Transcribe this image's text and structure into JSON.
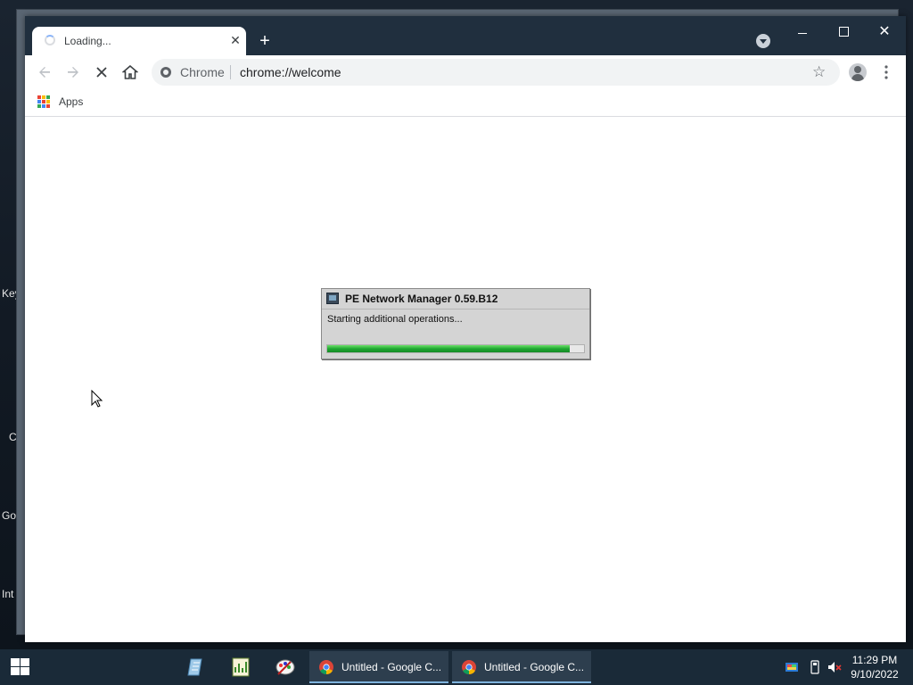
{
  "desktop": {
    "labels": [
      "Key",
      "C",
      "Go",
      "Int"
    ]
  },
  "browser": {
    "tab": {
      "title": "Loading..."
    },
    "omnibox": {
      "scheme_label": "Chrome",
      "url": "chrome://welcome"
    },
    "bookmarks": {
      "apps_label": "Apps"
    },
    "icons": {
      "back": "back-arrow-icon",
      "forward": "forward-arrow-icon",
      "stop": "stop-x-icon",
      "home": "home-icon",
      "star": "star-icon",
      "menu": "three-dot-menu-icon"
    }
  },
  "dialog": {
    "title": "PE Network Manager 0.59.B12",
    "status": "Starting additional operations...",
    "progress": 0.945
  },
  "taskbar": {
    "items": [
      {
        "label": "Untitled - Google C..."
      },
      {
        "label": "Untitled - Google C..."
      }
    ],
    "clock": {
      "time": "11:29 PM",
      "date": "9/10/2022"
    }
  },
  "colors": {
    "titlebar": "#202f3e",
    "taskbar": "#1a2a38",
    "progress_green": "#1fa832"
  }
}
